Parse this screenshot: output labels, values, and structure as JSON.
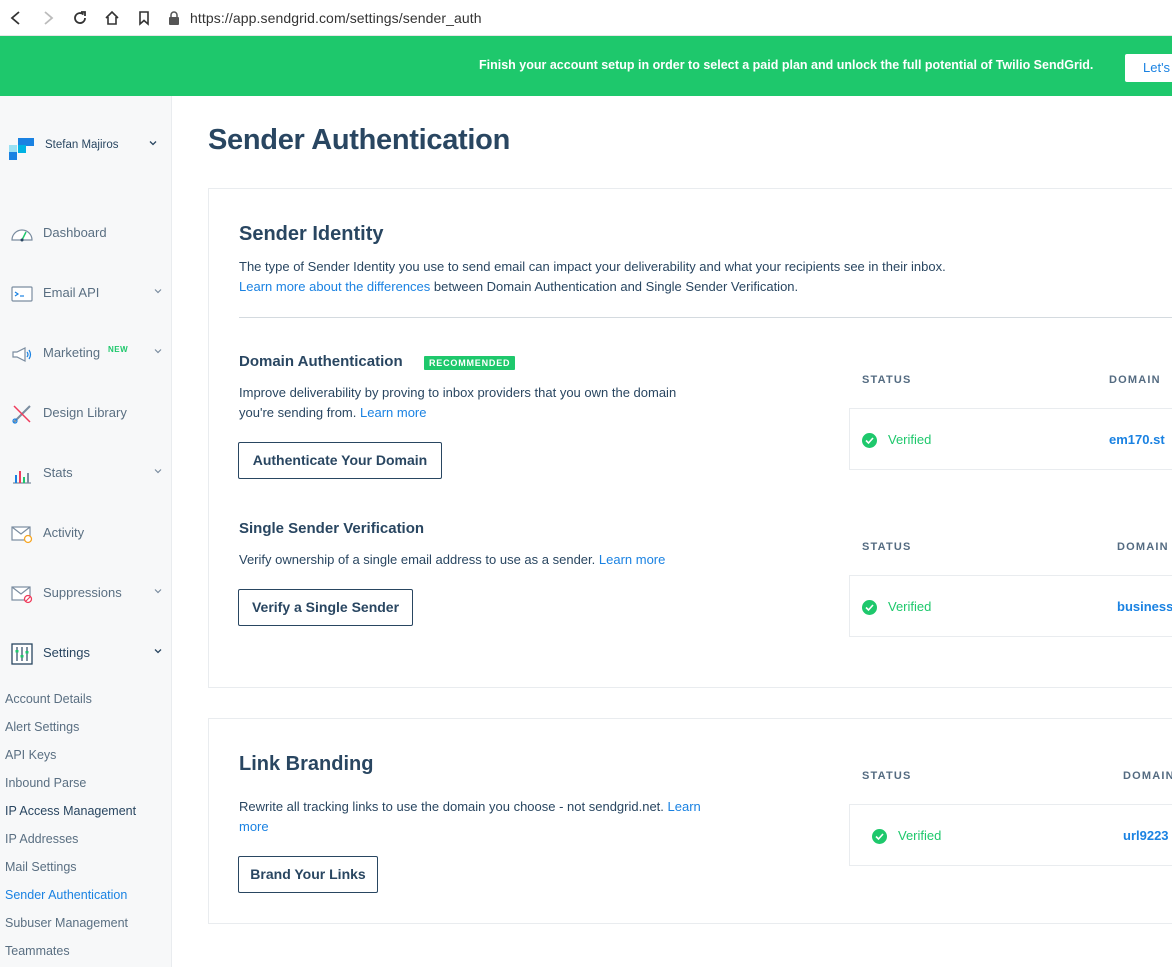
{
  "browser": {
    "url": "https://app.sendgrid.com/settings/sender_auth"
  },
  "banner": {
    "text": "Finish your account setup in order to select a paid plan and unlock the full potential of Twilio SendGrid.",
    "button_label": "Let's"
  },
  "account": {
    "name": "Stefan Majiros"
  },
  "sidebar": {
    "items": [
      {
        "label": "Dashboard",
        "icon": "dashboard-gauge-icon"
      },
      {
        "label": "Email API",
        "icon": "email-api-icon"
      },
      {
        "label": "Marketing",
        "badge": "NEW",
        "icon": "megaphone-icon"
      },
      {
        "label": "Design Library",
        "icon": "design-library-icon"
      },
      {
        "label": "Stats",
        "icon": "stats-chart-icon"
      },
      {
        "label": "Activity",
        "icon": "activity-icon"
      },
      {
        "label": "Suppressions",
        "icon": "suppressions-icon"
      },
      {
        "label": "Settings",
        "icon": "settings-sliders-icon"
      }
    ],
    "settings_sub": [
      "Account Details",
      "Alert Settings",
      "API Keys",
      "Inbound Parse",
      "IP Access Management",
      "IP Addresses",
      "Mail Settings",
      "Sender Authentication",
      "Subuser Management",
      "Teammates"
    ]
  },
  "page": {
    "title": "Sender Authentication"
  },
  "sender_identity": {
    "title": "Sender Identity",
    "description": "The type of Sender Identity you use to send email can impact your deliverability and what your recipients see in their inbox.",
    "link_text": "Learn more about the differences",
    "link_suffix": " between Domain Authentication and Single Sender Verification."
  },
  "domain_auth": {
    "title": "Domain Authentication",
    "badge": "RECOMMENDED",
    "desc_line1": "Improve deliverability by proving to inbox providers that you own the domain",
    "desc_line2": "you're sending from.",
    "learn_more": "Learn more",
    "button": "Authenticate Your Domain",
    "status_header": "STATUS",
    "domain_header": "DOMAIN",
    "status": "Verified",
    "domain": "em170.st"
  },
  "single_sender": {
    "title": "Single Sender Verification",
    "description": "Verify ownership of a single email address to use as a sender.",
    "learn_more": "Learn more",
    "button": "Verify a Single Sender",
    "status_header": "STATUS",
    "domain_header": "DOMAIN",
    "status": "Verified",
    "domain": "business"
  },
  "link_branding": {
    "title": "Link Branding",
    "desc_line1": "Rewrite all tracking links to use the domain you choose - not sendgrid.net.",
    "learn_more_1": "Learn",
    "learn_more_2": "more",
    "button": "Brand Your Links",
    "status_header": "STATUS",
    "domain_header": "DOMAIN",
    "status": "Verified",
    "domain": "url9223"
  },
  "colors": {
    "brand_green": "#1ec86c",
    "link_blue": "#1a82e2",
    "text_navy": "#294661"
  }
}
